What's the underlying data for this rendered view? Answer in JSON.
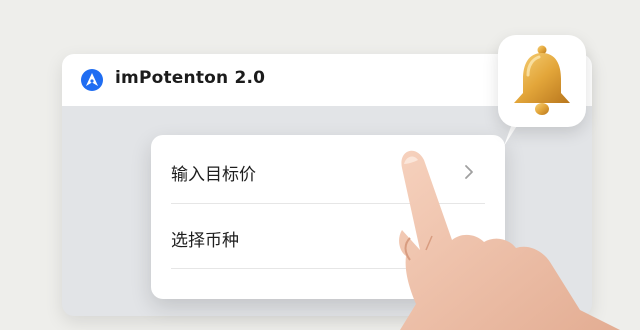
{
  "app": {
    "title": "imPotenton 2.0",
    "logo_icon": "brand-logo-icon"
  },
  "menu": {
    "items": [
      {
        "label": "输入目标价",
        "icon": "chevron-right-icon"
      },
      {
        "label": "选择币种"
      }
    ]
  },
  "notification": {
    "icon": "bell-icon"
  },
  "colors": {
    "brand_blue": "#1f6df2",
    "bell_gold": "#e0a83a",
    "background": "#eeeeeb"
  }
}
